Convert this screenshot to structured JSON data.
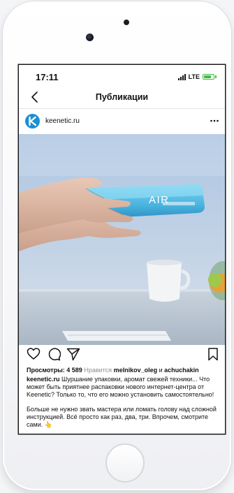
{
  "status": {
    "time": "17:11",
    "carrier": "LTE"
  },
  "nav": {
    "title": "Публикации"
  },
  "post": {
    "username": "keenetic.ru",
    "product_text": "AIR",
    "views_label": "Просмотры:",
    "views_count": "4 589",
    "likes_prefix": "Нравится",
    "liker1": "melnikov_oleg",
    "likes_and": "и",
    "liker2": "achuchakin",
    "caption_author": "keenetic.ru",
    "caption_text": "Шуршание упаковки, аромат свежей техники... Что может быть приятнее распаковки нового интернет-центра от Keenetic? Только то, что его можно установить самостоятельно!",
    "caption_more": "Больше не нужно звать мастера или ломать голову над сложной инструкцией. Всё просто как раз, два, три. Впрочем, смотрите сами. 👆"
  },
  "icons": {
    "back": "chevron-left-icon",
    "more": "more-dots-icon",
    "like": "heart-icon",
    "comment": "comment-icon",
    "share": "paper-plane-icon",
    "save": "bookmark-icon",
    "avatar": "keenetic-logo"
  },
  "colors": {
    "brand": "#1b90d4",
    "battery": "#3fbb3f",
    "product_box": "#5fc0e6",
    "muted_text": "#8e8e8e"
  }
}
